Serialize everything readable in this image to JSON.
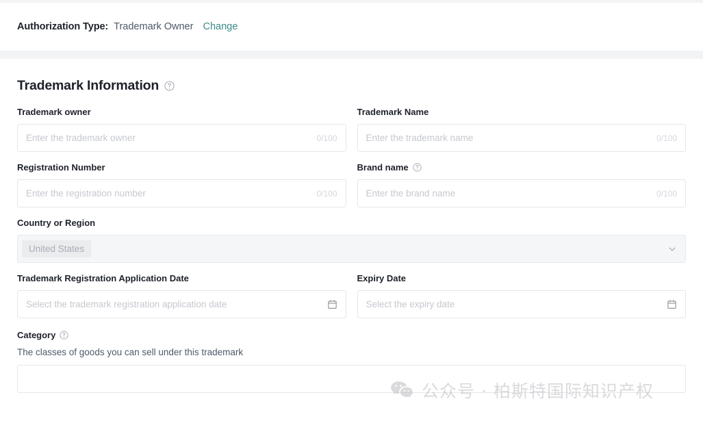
{
  "auth_bar": {
    "label": "Authorization Type:",
    "value": "Trademark Owner",
    "change_link": "Change"
  },
  "section": {
    "title": "Trademark Information",
    "help_icon": "question-circle-icon"
  },
  "fields": {
    "trademark_owner": {
      "label": "Trademark owner",
      "placeholder": "Enter the trademark owner",
      "value": "",
      "counter": "0/100"
    },
    "trademark_name": {
      "label": "Trademark Name",
      "placeholder": "Enter the trademark name",
      "value": "",
      "counter": "0/100"
    },
    "registration_number": {
      "label": "Registration Number",
      "placeholder": "Enter the registration number",
      "value": "",
      "counter": "0/100"
    },
    "brand_name": {
      "label": "Brand name",
      "placeholder": "Enter the brand name",
      "value": "",
      "counter": "0/100"
    },
    "country_or_region": {
      "label": "Country or Region",
      "selected": "United States",
      "disabled": true
    },
    "application_date": {
      "label": "Trademark Registration Application Date",
      "placeholder": "Select the trademark registration application date",
      "value": ""
    },
    "expiry_date": {
      "label": "Expiry Date",
      "placeholder": "Select the expiry date",
      "value": ""
    },
    "category": {
      "label": "Category",
      "description": "The classes of goods you can sell under this trademark"
    }
  },
  "watermark": {
    "text": "公众号 · 柏斯特国际知识产权",
    "logo": "wechat-icon"
  },
  "colors": {
    "link": "#3a8a89",
    "text_primary": "#1d2129",
    "text_secondary": "#4e5969",
    "placeholder": "#c5c8ce",
    "border": "#e5e6eb",
    "page_bg": "#f2f3f5",
    "disabled_bg": "#f5f6f7"
  }
}
